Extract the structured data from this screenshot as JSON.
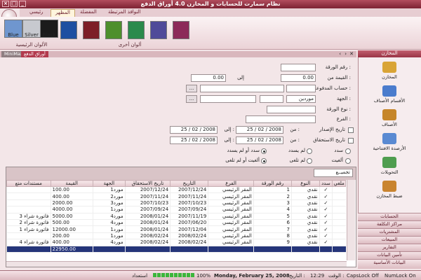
{
  "app_title": "نظام سمارت للحسابات و المخازن 4.0   أوراق الدفع",
  "ribbon_tabs": [
    "رئيسي",
    "المظهر",
    "النوافذ المرتبطة",
    "المفضلة"
  ],
  "theme_swatches": [
    {
      "label": "Blue",
      "color": "#6f96cf"
    },
    {
      "label": "Silver",
      "color": "#c7c9cf"
    },
    {
      "label": "Black",
      "color": "#1b1b1b"
    }
  ],
  "other_swatch_colors": [
    "#1e4fa1",
    "#7d1e27",
    "#4e8f2c",
    "#2b8a4c",
    "#4f4a99",
    "#8c2a59"
  ],
  "group_main_colors": "الألوان الرئيسية",
  "group_other_colors": "ألوان أخرى",
  "doc_tabs": {
    "active": "أوراق الدفع",
    "inactive": "MiniMax"
  },
  "form": {
    "paper_no_label": "رقم الورقة :",
    "value_from_label": "القيمة من :",
    "value_from": "0.00",
    "to_label": "إلى",
    "value_to": "0.00",
    "payments_account_label": "حساب المدفوعات :",
    "party_label": "الجهة :",
    "party_type": "موردين",
    "paper_type_label": "نوع الورقة :",
    "branch_label": "الفرع :",
    "issue_date_label": "تاريخ الإصدار",
    "due_date_label": "تاريخ الاستحقاق",
    "from_label": "من :",
    "to_label2": "إلى :",
    "date_from": "25 / 02 / 2008",
    "date_to": "25 / 02 / 2008",
    "radio_paid": "سدد",
    "radio_unpaid": "لم يسدد",
    "radio_paid_or_unpaid": "سدد أو لم يسدد",
    "radio_cancelled": "ألغيت",
    "radio_not_cancelled": "لم تلغى",
    "radio_cancelled_or_not": "ألغيت أو لم تلغى"
  },
  "total_button": "تجميــع",
  "table": {
    "headers": [
      "ملغي",
      "سدد",
      "النوع",
      "رقم الورقة",
      "الفرع",
      "التاريخ",
      "تاريخ الاستحقاق",
      "الجهة",
      "القيمة",
      "مستندات متع"
    ],
    "rows": [
      [
        "",
        "✓",
        "نقدي",
        "1",
        "المقر الرئيسي",
        "2007/12/24",
        "2007/12/24",
        "مورد1",
        "100.00",
        ""
      ],
      [
        "",
        "✓",
        "نقدي",
        "2",
        "المقر الرئيسي",
        "2007/11/24",
        "2007/11/24",
        "مورد2",
        "400.00",
        ""
      ],
      [
        "",
        "✓",
        "نقدي",
        "3",
        "المقر الرئيسي",
        "2007/10/23",
        "2007/10/23",
        "مورد3",
        "2000.00",
        ""
      ],
      [
        "",
        "✓",
        "نقدي",
        "4",
        "المقر الرئيسي",
        "2007/09/24",
        "2007/09/24",
        "مورد1",
        "4000.00",
        ""
      ],
      [
        "",
        "✓",
        "نقدي",
        "5",
        "المقر الرئيسي",
        "2007/11/19",
        "2008/01/24",
        "مورد4",
        "5000.00",
        "فاتورة شراء 3"
      ],
      [
        "",
        "✓",
        "نقدي",
        "6",
        "المقر الرئيسي",
        "2007/06/20",
        "2008/01/24",
        "مورد4",
        "500.00",
        "فاتورة شراء 2"
      ],
      [
        "",
        "✓",
        "نقدي",
        "7",
        "المقر الرئيسي",
        "2007/12/04",
        "2008/01/24",
        "مورد1",
        "12000.00",
        "فاتورة شراء 1"
      ],
      [
        "",
        "✓",
        "نقدي",
        "8",
        "المقر الرئيسي",
        "2008/02/24",
        "2008/02/24",
        "مورد1",
        "200.00",
        ""
      ],
      [
        "",
        "✓",
        "نقدي",
        "9",
        "المقر الرئيسي",
        "2008/02/24",
        "2008/02/24",
        "مورد4",
        "400.00",
        "فاتورة شراء 4"
      ]
    ],
    "total": "22950.00"
  },
  "nav": {
    "header": "المخازن",
    "items": [
      {
        "label": "المخازن",
        "icon": "box-icon",
        "color": "#d9a436"
      },
      {
        "label": "الأقسام الأصناف",
        "icon": "tree-icon",
        "color": "#4b7ccd"
      },
      {
        "label": "الأصناف",
        "icon": "items-icon",
        "color": "#c6862a"
      },
      {
        "label": "الأرصدة الافتتاحية",
        "icon": "balance-icon",
        "color": "#5a8ad2"
      },
      {
        "label": "التحويلات",
        "icon": "transfer-icon",
        "color": "#4f9d4f"
      },
      {
        "label": "ضبط المخازن",
        "icon": "adjust-icon",
        "color": "#c9842f"
      }
    ],
    "buttons": [
      "الحسابات",
      "مراكز التكلفة",
      "المشتريات",
      "المبيعات",
      "التقارير",
      "تأمين البيانات",
      "البيانات الأساسية"
    ]
  },
  "status": {
    "numlock": "NumLock On",
    "capslock": "CapsLock Off",
    "time_label": "الوقت :",
    "time": "12:29",
    "date_label": "التاريخ :",
    "date": "Monday, February 25, 2008",
    "zoom": "100%",
    "ready": "استعداد"
  }
}
